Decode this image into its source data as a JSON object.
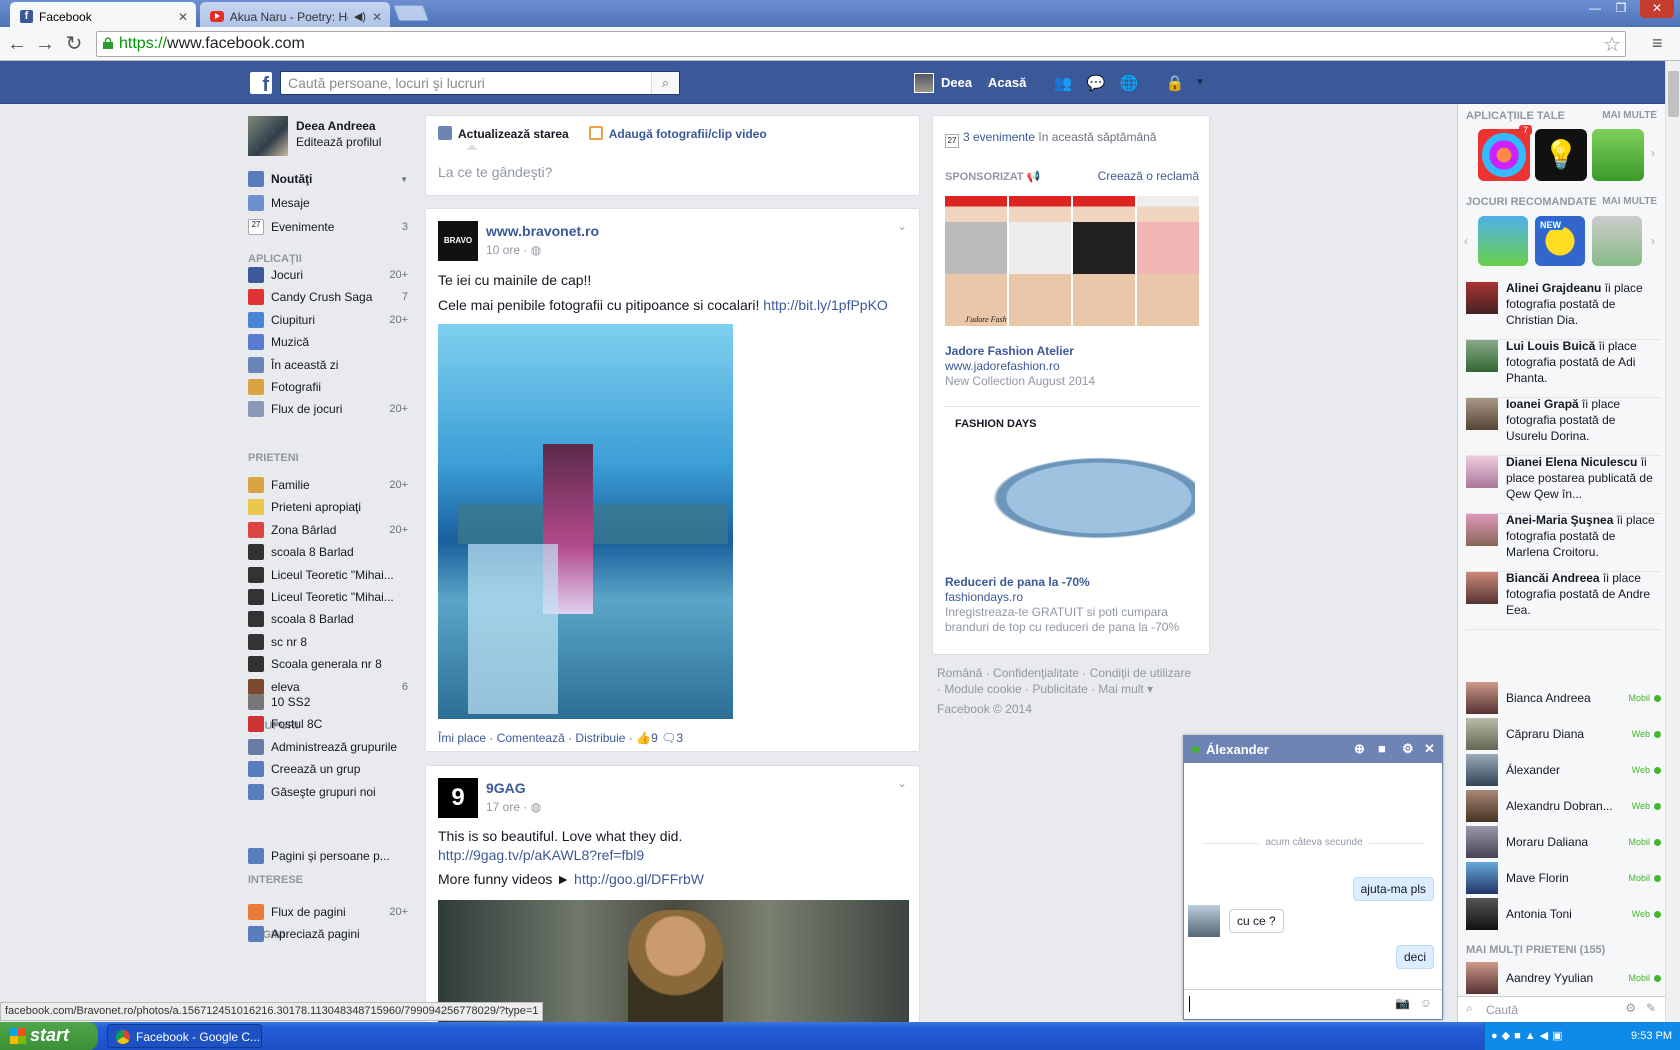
{
  "browser": {
    "tabs": [
      {
        "title": "Facebook",
        "active": true
      },
      {
        "title": "Akua Naru - Poetry: How",
        "active": false
      }
    ],
    "url_scheme": "https://",
    "url_host": "www.facebook.com",
    "status_url": "facebook.com/Bravonet.ro/photos/a.156712451016216.30178.113048348715960/799094256778029/?type=1"
  },
  "header": {
    "logo": "f",
    "search_placeholder": "Caută persoane, locuri şi lucruri",
    "user_name": "Deea",
    "home_label": "Acasă"
  },
  "profile": {
    "name": "Deea Andreea",
    "edit_label": "Editează profilul"
  },
  "leftnav": {
    "favorites": [
      {
        "label": "Noutăţi",
        "count": "",
        "icon": "news-feed-icon"
      },
      {
        "label": "Mesaje",
        "count": "",
        "icon": "messages-icon"
      },
      {
        "label": "Evenimente",
        "count": "3",
        "icon": "events-icon"
      }
    ],
    "apps_head": "APLICAŢII",
    "apps": [
      {
        "label": "Jocuri",
        "count": "20+"
      },
      {
        "label": "Candy Crush Saga",
        "count": "7"
      },
      {
        "label": "Ciupituri",
        "count": "20+"
      },
      {
        "label": "Muzică",
        "count": ""
      },
      {
        "label": "În această zi",
        "count": ""
      },
      {
        "label": "Fotografii",
        "count": ""
      },
      {
        "label": "Flux de jocuri",
        "count": "20+"
      }
    ],
    "friends_head": "PRIETENI",
    "friends": [
      {
        "label": "Familie",
        "count": "20+"
      },
      {
        "label": "Prieteni apropiaţi",
        "count": ""
      },
      {
        "label": "Zona Bârlad",
        "count": "20+"
      },
      {
        "label": "scoala 8 Barlad",
        "count": ""
      },
      {
        "label": "Liceul Teoretic \"Mihai...",
        "count": ""
      },
      {
        "label": "Liceul Teoretic \"Mihai...",
        "count": ""
      },
      {
        "label": "scoala 8 Barlad",
        "count": ""
      },
      {
        "label": "sc nr 8",
        "count": ""
      },
      {
        "label": "Scoala generala nr 8",
        "count": ""
      },
      {
        "label": "eleva",
        "count": "6"
      }
    ],
    "groups_head": "GRUPURI",
    "groups": [
      {
        "label": "10 SS2",
        "count": ""
      },
      {
        "label": "Fostul 8C",
        "count": ""
      },
      {
        "label": "Administrează grupurile",
        "count": ""
      },
      {
        "label": "Creează un grup",
        "count": ""
      },
      {
        "label": "Găseşte grupuri noi",
        "count": ""
      }
    ],
    "interests_head": "INTERESE",
    "interests": [
      {
        "label": "Pagini şi persoane p...",
        "count": ""
      }
    ],
    "pages_head": "PAGINI",
    "pages": [
      {
        "label": "Flux de pagini",
        "count": "20+"
      },
      {
        "label": "Apreciază pagini",
        "count": ""
      }
    ]
  },
  "composer": {
    "tab_status": "Actualizează starea",
    "tab_photo": "Adaugă fotografii/clip video",
    "placeholder": "La ce te gândeşti?"
  },
  "posts": [
    {
      "author": "www.bravonet.ro",
      "avatar_text": "BRAVO",
      "time": "10 ore",
      "line1": "Te iei cu mainile de cap!!",
      "line2": "Cele mai penibile fotografii cu pitipoance si cocalari!",
      "link": "http://bit.ly/1pfPpKO",
      "like": "Îmi place",
      "comment": "Comentează",
      "share": "Distribuie",
      "likes": "9",
      "comments": "3"
    },
    {
      "author": "9GAG",
      "time": "17 ore",
      "line1": "This is so beautiful. Love what they did.",
      "link1": "http://9gag.tv/p/aKAWL8?ref=fbl9",
      "line2": "More funny videos ►",
      "link2": "http://goo.gl/DFFrbW"
    }
  ],
  "rightcol": {
    "events_count": "3 evenimente",
    "events_rest": " în această săptămână",
    "events_cal": "27",
    "sponsored": "SPONSORIZAT",
    "create_ad": "Creează o reclamă",
    "ads": [
      {
        "title": "Jadore Fashion Atelier",
        "domain": "www.jadorefashion.ro",
        "desc": "New Collection August 2014",
        "brand": "J'adore Fash"
      },
      {
        "title": "Reduceri de pana la -70%",
        "domain": "fashiondays.ro",
        "desc": "Inregistreaza-te GRATUIT si poti cumpara branduri de top cu reduceri de pana la -70%",
        "brand": "FASHION DAYS"
      }
    ],
    "footer_line1": "Română · Confidenţialitate · Condiţii de utilizare",
    "footer_line2": "· Module cookie · Publicitate · Mai mult ▾",
    "footer_line3": "Facebook © 2014"
  },
  "sidebar": {
    "apps_head": "APLICAŢIILE TALE",
    "apps_more": "MAI MULTE",
    "apps_badge": "7",
    "games_head": "JOCURI RECOMANDATE",
    "games_more": "MAI MULTE",
    "games_badge": "NEW",
    "ticker": [
      {
        "name": "Alinei Grajdeanu",
        "rest": " îi place fotografia postată de Christian Dia."
      },
      {
        "name": "Lui Louis Buică",
        "rest": " îi place fotografia postată de Adi Phanta."
      },
      {
        "name": "Ioanei Grapă",
        "rest": " îi place fotografia postată de Usurelu Dorina."
      },
      {
        "name": "Dianei Elena Niculescu",
        "rest": " îi place postarea publicată de Qew Qew în..."
      },
      {
        "name": "Anei-Maria Şuşnea",
        "rest": " îi place fotografia postată de Marlena Croitoru."
      },
      {
        "name": "Biancăi Andreea",
        "rest": " îi place fotografia postată de Andre Eea."
      }
    ],
    "online": [
      {
        "name": "Bianca Andreea",
        "status": "Mobil"
      },
      {
        "name": "Căpraru Diana",
        "status": "Web"
      },
      {
        "name": "Álexander",
        "status": "Web"
      },
      {
        "name": "Alexandru Dobran...",
        "status": "Web"
      },
      {
        "name": "Moraru Daliana",
        "status": "Mobil"
      },
      {
        "name": "Mave Florin",
        "status": "Mobil"
      },
      {
        "name": "Antonia Toni",
        "status": "Web"
      }
    ],
    "more_friends": "MAI MULŢI PRIETENI (155)",
    "more_list": [
      {
        "name": "Aandrey Yyulian",
        "status": "Mobil"
      }
    ],
    "search_placeholder": "Caută"
  },
  "chat": {
    "name": "Álexander",
    "timestamp": "acum câteva secunde",
    "messages": [
      {
        "from": "me",
        "text": "ajuta-ma pls"
      },
      {
        "from": "them",
        "text": "cu ce ?"
      },
      {
        "from": "me",
        "text": "deci"
      }
    ]
  },
  "taskbar": {
    "start": "start",
    "window": "Facebook - Google C...",
    "clock": "9:53 PM"
  },
  "colors": {
    "fb_blue": "#3b5998",
    "chat_header": "#6d84b4",
    "online_green": "#42b72a"
  }
}
